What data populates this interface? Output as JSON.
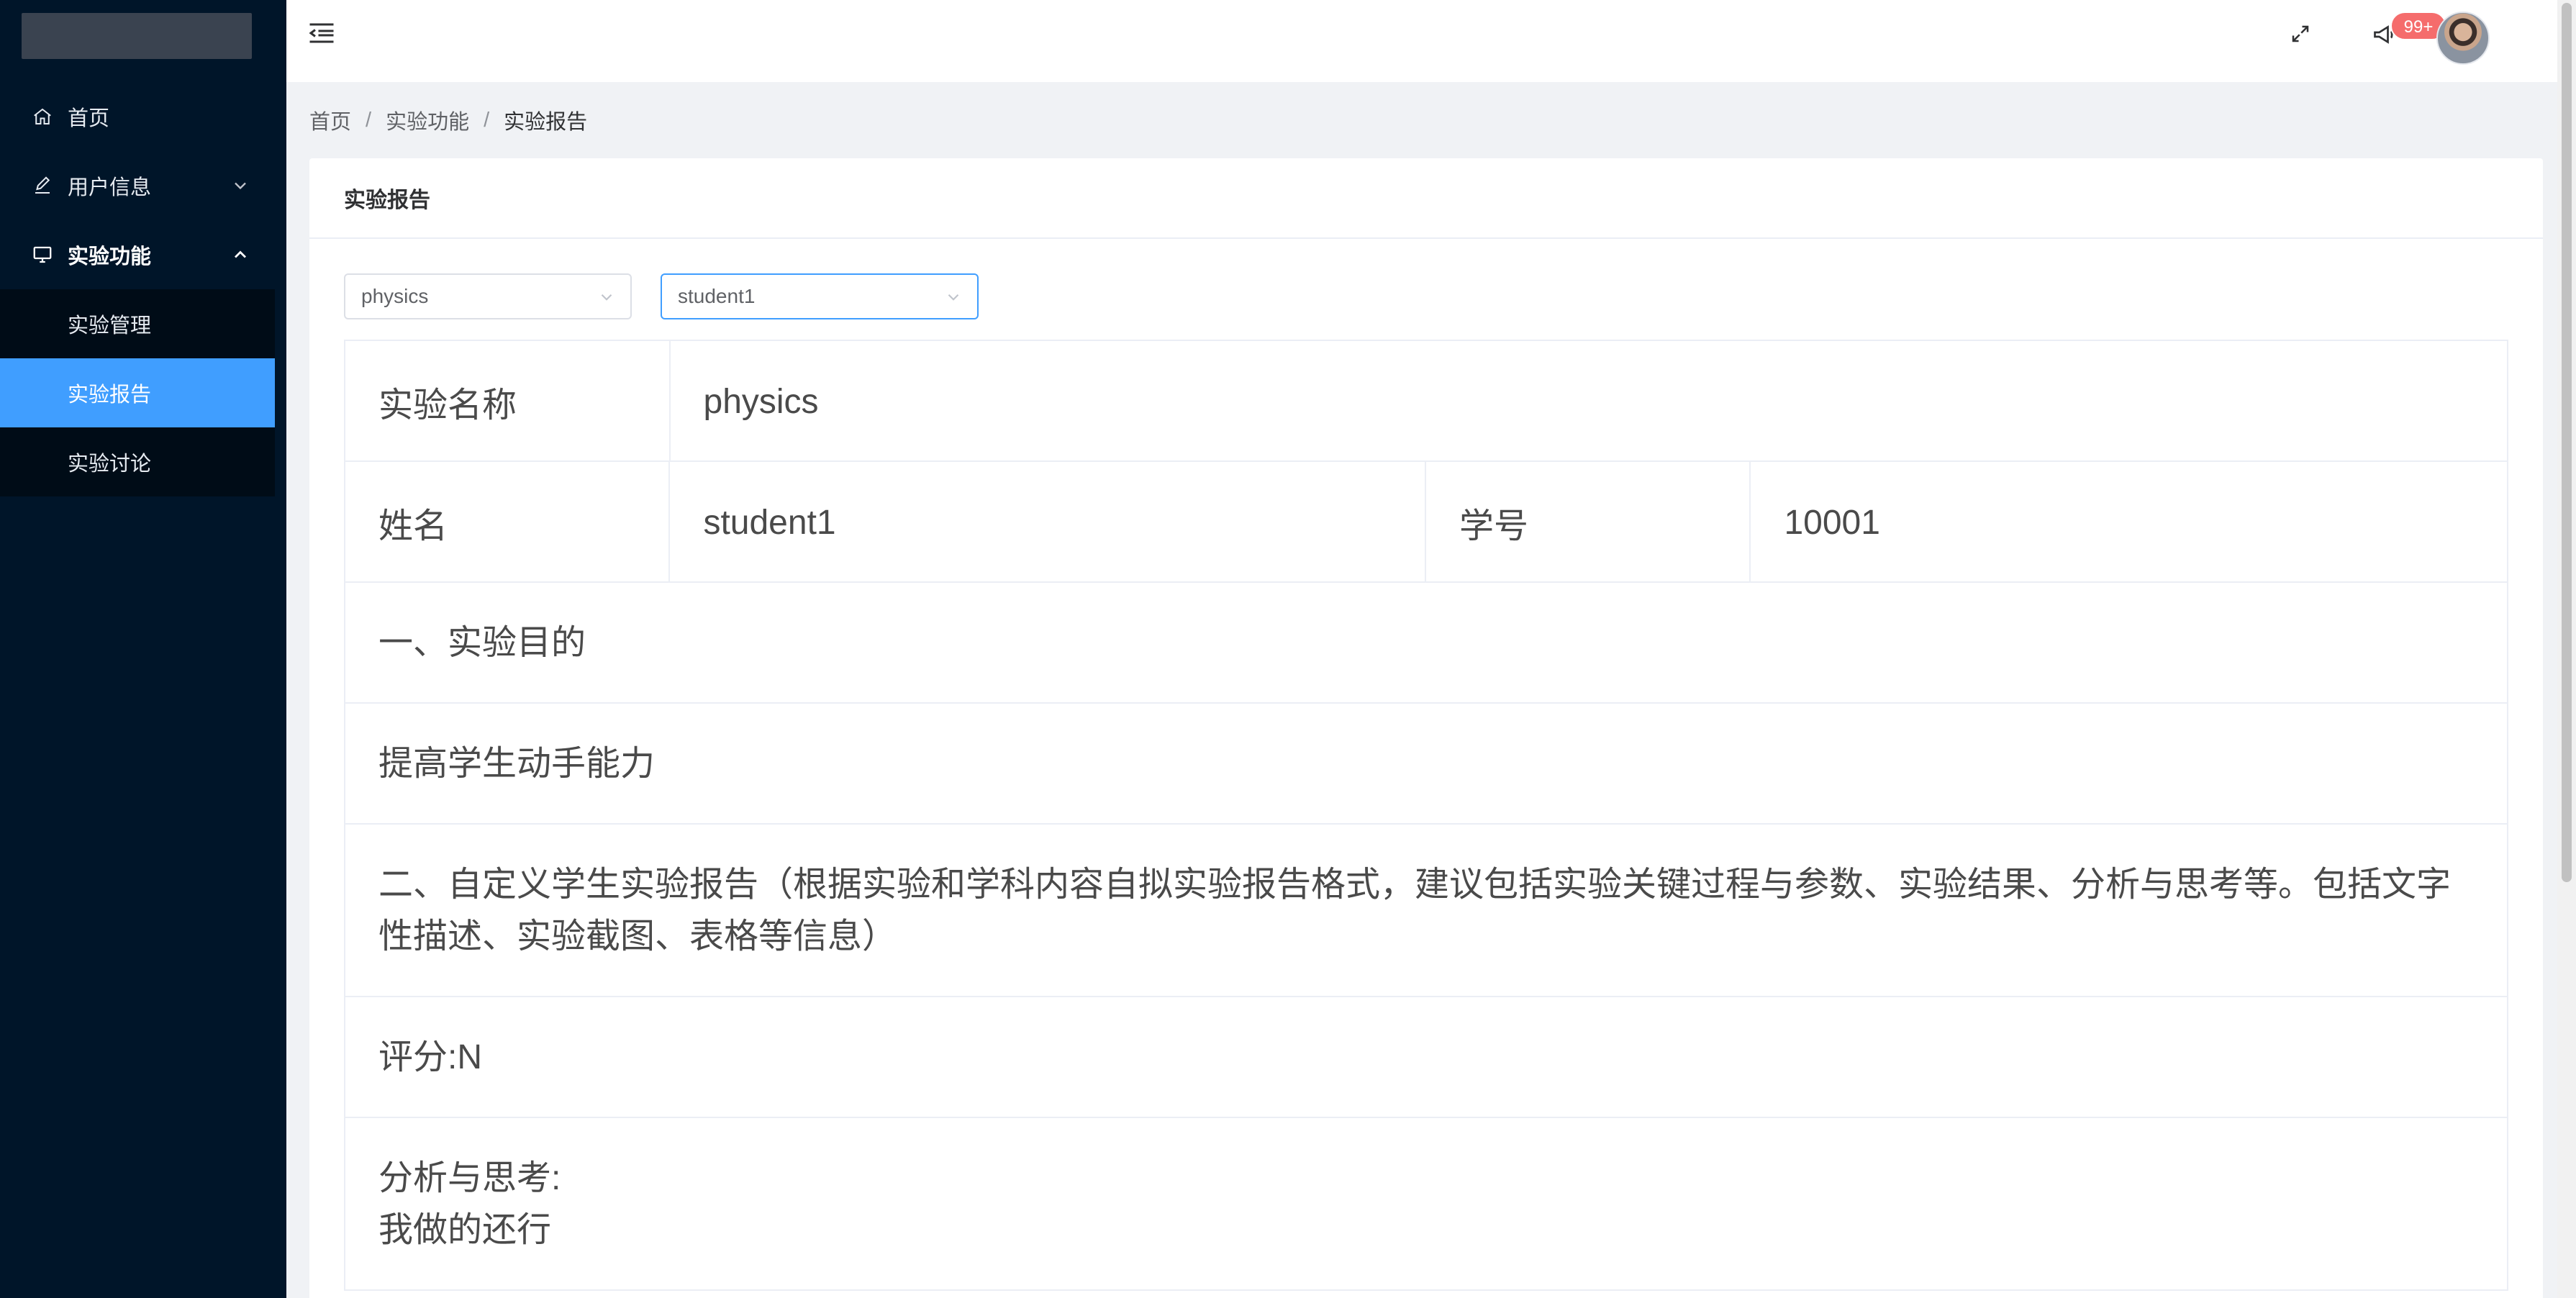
{
  "sidebar": {
    "items": [
      {
        "label": "首页",
        "icon": "home-icon"
      },
      {
        "label": "用户信息",
        "icon": "edit-icon",
        "expanded": false
      },
      {
        "label": "实验功能",
        "icon": "monitor-icon",
        "expanded": true,
        "children": [
          {
            "label": "实验管理",
            "active": false
          },
          {
            "label": "实验报告",
            "active": true
          },
          {
            "label": "实验讨论",
            "active": false
          }
        ]
      }
    ]
  },
  "header": {
    "notification_badge": "99+"
  },
  "breadcrumb": [
    "首页",
    "实验功能",
    "实验报告"
  ],
  "card": {
    "title": "实验报告",
    "experiment_select": {
      "value": "physics"
    },
    "student_select": {
      "value": "student1"
    }
  },
  "report": {
    "experiment_name_label": "实验名称",
    "experiment_name_value": "physics",
    "name_label": "姓名",
    "name_value": "student1",
    "student_id_label": "学号",
    "student_id_value": "10001",
    "section1_title": "一、实验目的",
    "section1_content": "提高学生动手能力",
    "section2_title_line1": "二、自定义学生实验报告（根据实验和学科内容自拟实验报告格式，建议包括实验关键过程与参数、实验结果、分析与思考等。包括文字",
    "section2_title_line2": "性描述、实验截图、表格等信息）",
    "score": "评分:N",
    "analysis_label": "分析与思考:",
    "analysis_content": "我做的还行"
  },
  "colors": {
    "sidebar_bg": "#001529",
    "submenu_bg": "#000c17",
    "active": "#409eff",
    "badge": "#f56c6c"
  }
}
